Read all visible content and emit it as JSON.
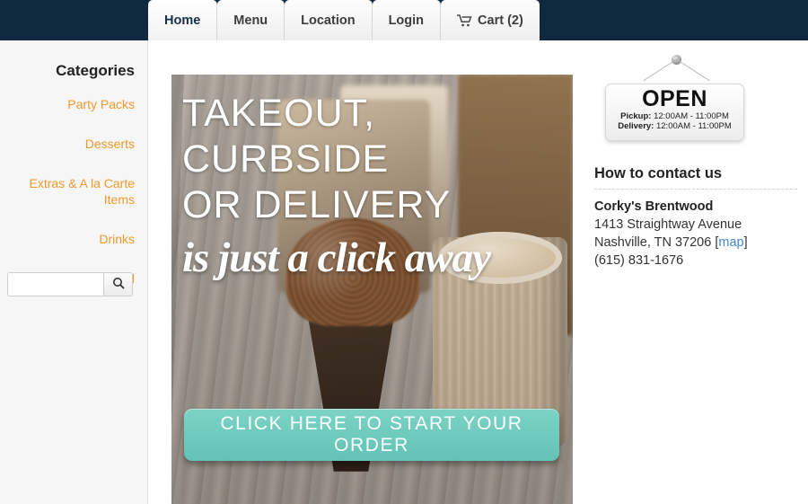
{
  "nav": {
    "tabs": [
      {
        "label": "Home",
        "active": true
      },
      {
        "label": "Menu",
        "active": false
      },
      {
        "label": "Location",
        "active": false
      },
      {
        "label": "Login",
        "active": false
      },
      {
        "label": "Cart (2)",
        "active": false,
        "icon": "cart-icon"
      }
    ]
  },
  "sidebar": {
    "title": "Categories",
    "categories": [
      {
        "label": "Party Packs"
      },
      {
        "label": "Desserts"
      },
      {
        "label": "Extras & A la Carte Items"
      },
      {
        "label": "Drinks"
      },
      {
        "label": "View All"
      }
    ],
    "search": {
      "value": "",
      "placeholder": "",
      "icon": "search-icon"
    }
  },
  "banner": {
    "line1": "TAKEOUT,",
    "line2": "CURBSIDE",
    "line3": "OR DELIVERY",
    "script": "is just a click away",
    "cta": "CLICK HERE TO START YOUR ORDER"
  },
  "status_sign": {
    "status": "OPEN",
    "pickup_label": "Pickup:",
    "pickup_hours": "12:00AM - 11:00PM",
    "delivery_label": "Delivery:",
    "delivery_hours": "12:00AM - 11:00PM"
  },
  "contact": {
    "heading": "How to contact us",
    "name": "Corky's Brentwood",
    "address1": "1413 Straightway Avenue",
    "city_state_zip": "Nashville, TN 37206",
    "map_open": "[",
    "map_label": "map",
    "map_close": "]",
    "phone": "(615) 831-1676"
  },
  "colors": {
    "header_navy": "#10293f",
    "link_orange": "#f0992e",
    "cta_teal": "#68c7ba",
    "map_blue": "#3a89c9"
  }
}
